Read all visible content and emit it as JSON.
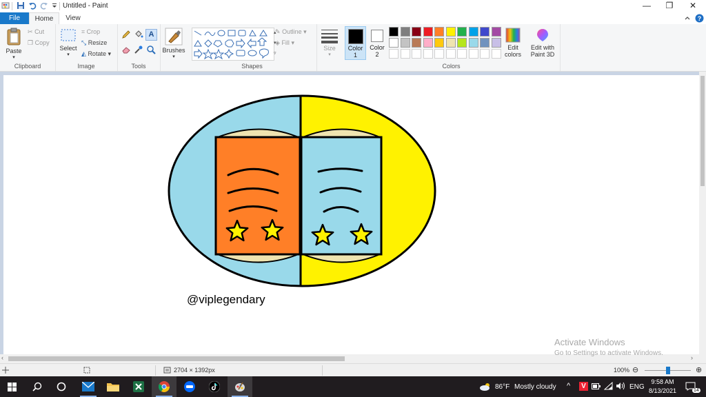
{
  "window": {
    "title": "Untitled - Paint",
    "controls": [
      "—",
      "❐",
      "✕"
    ]
  },
  "ribbon_tabs": [
    "File",
    "Home",
    "View"
  ],
  "clipboard": {
    "paste_label": "Paste",
    "cut_label": "Cut",
    "copy_label": "Copy",
    "group_label": "Clipboard"
  },
  "image": {
    "select_label": "Select",
    "crop_label": "Crop",
    "resize_label": "Resize",
    "rotate_label": "Rotate",
    "group_label": "Image"
  },
  "tools": {
    "group_label": "Tools",
    "brushes_label": "Brushes",
    "text_tool_glyph": "A"
  },
  "shapes": {
    "group_label": "Shapes",
    "outline_label": "Outline",
    "fill_label": "Fill"
  },
  "size": {
    "label": "Size"
  },
  "colors": {
    "group_label": "Colors",
    "color1_label": "Color",
    "color1_num": "1",
    "color2_label": "Color",
    "color2_num": "2",
    "color1_value": "#000000",
    "color2_value": "#ffffff",
    "edit_colors_line1": "Edit",
    "edit_colors_line2": "colors",
    "paint3d_line1": "Edit with",
    "paint3d_line2": "Paint 3D",
    "palette_row1": [
      "#000000",
      "#7f7f7f",
      "#880015",
      "#ed1c24",
      "#ff7f27",
      "#fff200",
      "#22b14c",
      "#00a2e8",
      "#3f48cc",
      "#a349a4"
    ],
    "palette_row2": [
      "#ffffff",
      "#c3c3c3",
      "#b97a57",
      "#ffaec9",
      "#ffc90e",
      "#efe4b0",
      "#b5e61d",
      "#99d9ea",
      "#7092be",
      "#c8bfe7"
    ]
  },
  "drawing": {
    "left_half_color": "#99d9ea",
    "right_half_color": "#fff200",
    "left_page_color": "#ff7f27",
    "right_page_color": "#99d9ea",
    "page_edge_color": "#efe4b0",
    "star_color": "#fff200",
    "signature": "@viplegendary"
  },
  "watermark": {
    "title": "Activate Windows",
    "subtitle": "Go to Settings to activate Windows."
  },
  "status": {
    "image_size": "2704 × 1392px",
    "zoom": "100%"
  },
  "taskbar": {
    "weather_temp": "86°F",
    "weather_desc": "Mostly cloudy",
    "language": "ENG",
    "time": "9:58 AM",
    "date": "8/13/2021",
    "notification_count": "14"
  }
}
